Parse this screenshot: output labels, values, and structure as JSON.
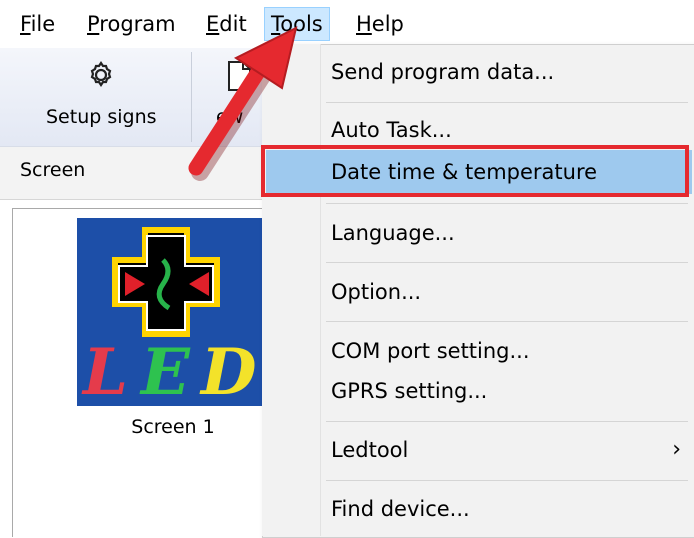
{
  "menubar": {
    "items": [
      {
        "label": "File",
        "mnemonic": "F",
        "rest": "ile"
      },
      {
        "label": "Program",
        "mnemonic": "P",
        "rest": "rogram"
      },
      {
        "label": "Edit",
        "mnemonic": "E",
        "rest": "dit"
      },
      {
        "label": "Tools",
        "mnemonic": "T",
        "rest": "ools"
      },
      {
        "label": "Help",
        "mnemonic": "H",
        "rest": "elp"
      }
    ],
    "active": "Tools"
  },
  "toolbar": {
    "setup_signs_label": "Setup signs",
    "new_label_partial": "ew"
  },
  "screenbar": {
    "label": "Screen"
  },
  "screens": [
    {
      "caption": "Screen 1",
      "thumbnail_text": "LED"
    }
  ],
  "tools_menu": {
    "items": [
      {
        "label": "Send program data..."
      },
      {
        "label": "Auto Task..."
      },
      {
        "label": "Date time & temperature",
        "highlighted": true
      },
      {
        "label": "Language..."
      },
      {
        "label": "Option..."
      },
      {
        "label": "COM port setting..."
      },
      {
        "label": "GPRS setting..."
      },
      {
        "label": "Ledtool",
        "submenu_indicator": "›"
      },
      {
        "label": "Find device..."
      }
    ]
  },
  "colors": {
    "highlight": "#9ec9ee",
    "annotation_red": "#e5292f",
    "thumbnail_bg": "#1d4fa8"
  }
}
